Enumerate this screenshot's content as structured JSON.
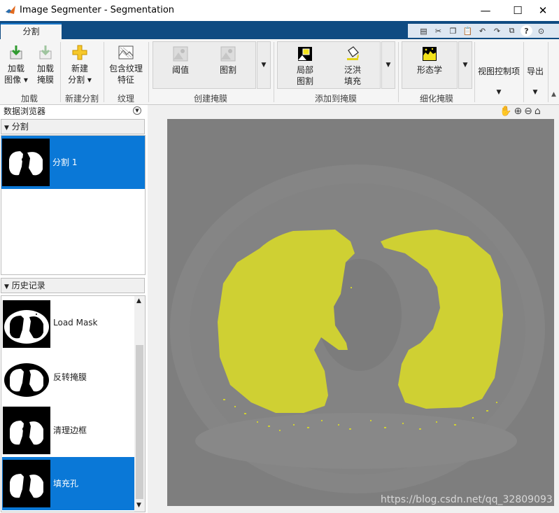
{
  "window": {
    "title": "Image Segmenter - Segmentation",
    "minimize": "—",
    "maximize": "☐",
    "close": "✕"
  },
  "tabs": [
    {
      "label": "分割",
      "active": true
    }
  ],
  "ribbon": {
    "load": {
      "load_image": [
        "加载",
        "图像 ▾"
      ],
      "load_mask": [
        "加载",
        "掩膜"
      ],
      "section": "加载"
    },
    "new_segment": {
      "button": [
        "新建",
        "分割 ▾"
      ],
      "section": "新建分割"
    },
    "texture": {
      "button": [
        "包含纹理",
        "特征"
      ],
      "section": "纹理"
    },
    "create_mask": {
      "threshold": "阈值",
      "graph_cut": "图割",
      "section": "创建掩膜"
    },
    "add_to_mask": {
      "local_graph_cut": [
        "局部",
        "图割"
      ],
      "flood_fill": [
        "泛洪",
        "填充"
      ],
      "section": "添加到掩膜"
    },
    "refine_mask": {
      "morphology": "形态学",
      "section": "细化掩膜"
    },
    "view_controls": "视图控制项",
    "export": "导出"
  },
  "data_browser": {
    "title": "数据浏览器",
    "segmentation_header": "分割",
    "segments": [
      {
        "label": "分割 1",
        "selected": true
      }
    ],
    "history_header": "历史记录",
    "history": [
      {
        "label": "Load Mask",
        "selected": false
      },
      {
        "label": "反转掩膜",
        "selected": false
      },
      {
        "label": "清理边框",
        "selected": false
      },
      {
        "label": "填充孔",
        "selected": true
      }
    ]
  },
  "viewer_tools": [
    "hand-icon",
    "zoom-in-icon",
    "zoom-out-icon",
    "home-icon"
  ],
  "colors": {
    "accent": "#0a78d7",
    "tabstrip": "#0f4b82",
    "mask": "#cfd033"
  },
  "watermark": "https://blog.csdn.net/qq_32809093"
}
